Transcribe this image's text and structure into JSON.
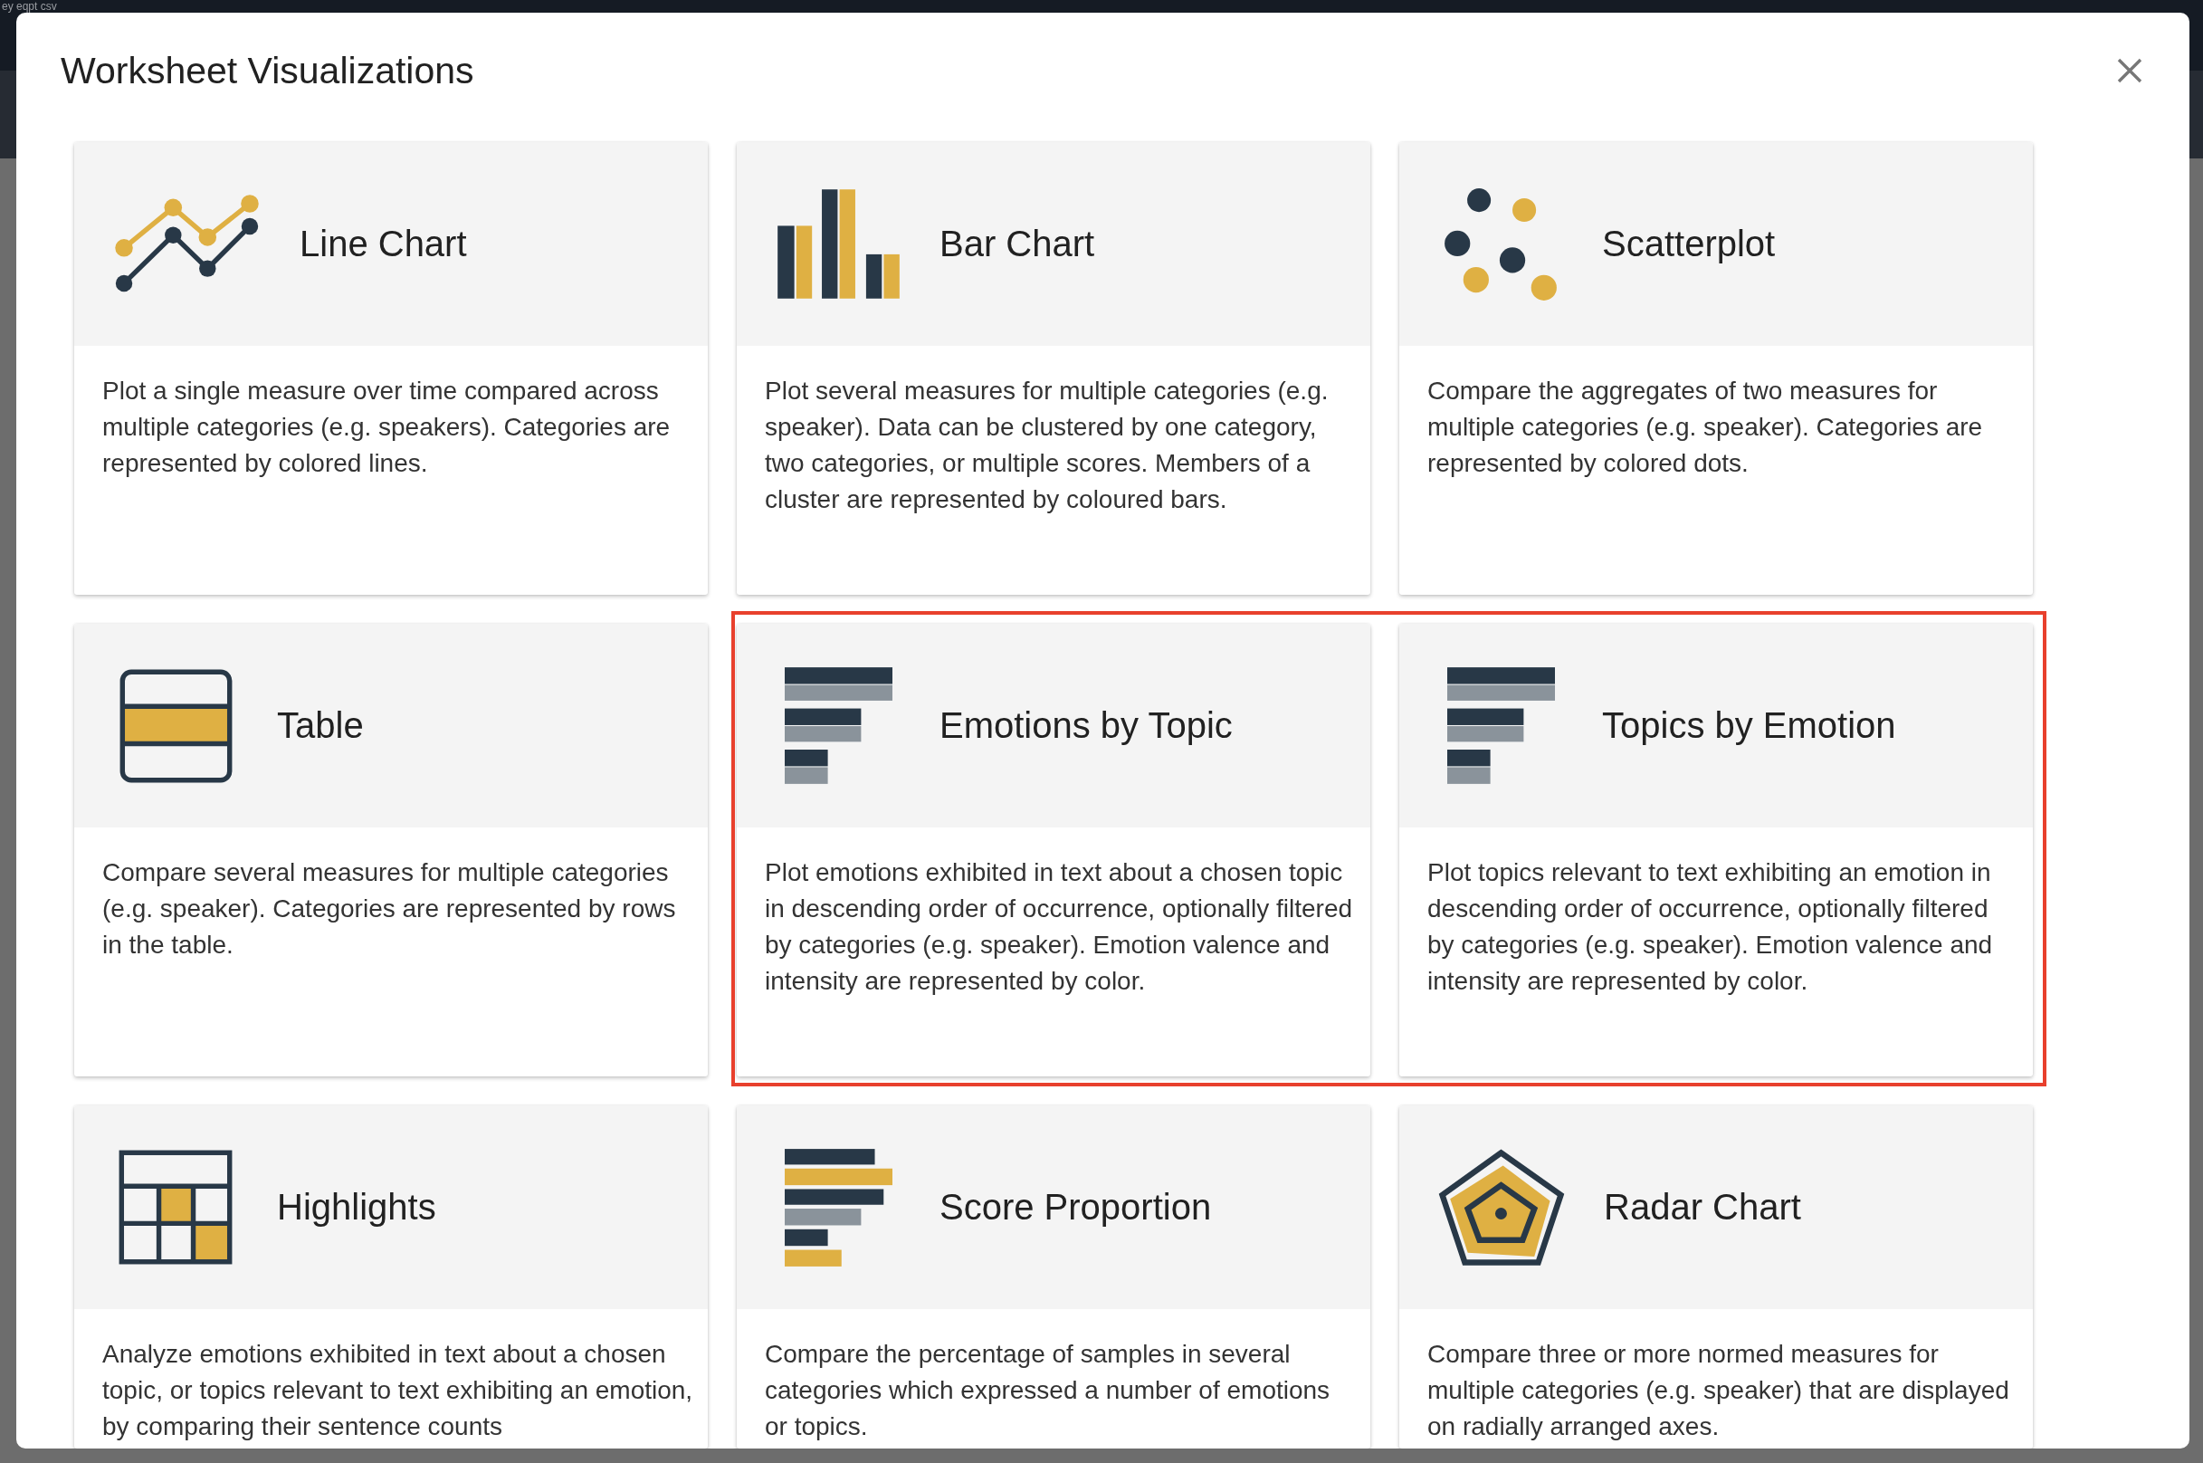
{
  "background": {
    "file_title": "ey eqpt csv"
  },
  "dialog": {
    "title": "Worksheet Visualizations"
  },
  "cards": [
    {
      "kind": "line",
      "title": "Line Chart",
      "description": "Plot a single measure over time compared across multiple categories (e.g. speakers). Categories are represented by colored lines.",
      "highlighted": false
    },
    {
      "kind": "bar",
      "title": "Bar Chart",
      "description": "Plot several measures for multiple categories (e.g. speaker). Data can be clustered by one category, two categories, or multiple scores. Members of a cluster are represented by coloured bars.",
      "highlighted": false
    },
    {
      "kind": "scatter",
      "title": "Scatterplot",
      "description": "Compare the aggregates of two measures for multiple categories (e.g. speaker). Categories are represented by colored dots.",
      "highlighted": false
    },
    {
      "kind": "table",
      "title": "Table",
      "description": "Compare several measures for multiple categories (e.g. speaker). Categories are represented by rows in the table.",
      "highlighted": false
    },
    {
      "kind": "ranked",
      "title": "Emotions by Topic",
      "description": "Plot emotions exhibited in text about a chosen topic in descending order of occurrence, optionally filtered by categories (e.g. speaker). Emotion valence and intensity are represented by color.",
      "highlighted": true
    },
    {
      "kind": "ranked",
      "title": "Topics by Emotion",
      "description": "Plot topics relevant to text exhibiting an emotion in descending order of occurrence, optionally filtered by categories (e.g. speaker). Emotion valence and intensity are represented by color.",
      "highlighted": true
    },
    {
      "kind": "highlights",
      "title": "Highlights",
      "description": "Analyze emotions exhibited in text about a chosen topic, or topics relevant to text exhibiting an emotion, by comparing their sentence counts",
      "highlighted": false
    },
    {
      "kind": "proportion",
      "title": "Score Proportion",
      "description": "Compare the percentage of samples in several categories which expressed a number of emotions or topics.",
      "highlighted": false
    },
    {
      "kind": "radar",
      "title": "Radar Chart",
      "description": "Compare three or more normed measures for multiple categories (e.g. speaker) that are displayed on radially arranged axes.",
      "highlighted": false
    }
  ]
}
